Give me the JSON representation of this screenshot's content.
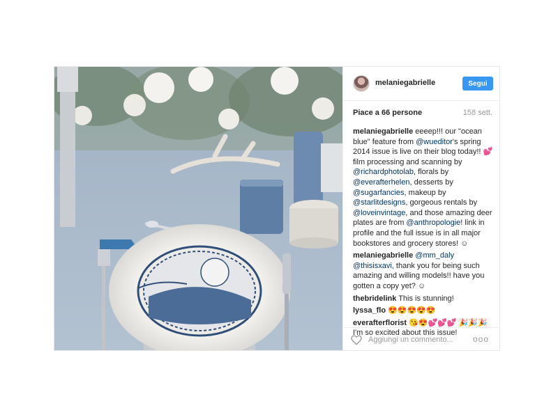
{
  "post": {
    "username": "melaniegabrielle",
    "follow_label": "Segui",
    "likes": "Piace a 66 persone",
    "time_ago": "158 sett.",
    "comment_placeholder": "Aggiungi un commento...",
    "more_label": "ooo"
  },
  "comments": [
    {
      "user": "melaniegabrielle",
      "parts": [
        {
          "t": " eeeep!!! our \"ocean blue\" feature from "
        },
        {
          "t": "@wueditor",
          "m": true
        },
        {
          "t": "'s spring 2014 issue is live on their blog today!! 💕 film processing and scanning by "
        },
        {
          "t": "@richardphotolab",
          "m": true
        },
        {
          "t": ", florals by "
        },
        {
          "t": "@everafterhelen",
          "m": true
        },
        {
          "t": ", desserts by "
        },
        {
          "t": "@sugarfancies",
          "m": true
        },
        {
          "t": ", makeup by "
        },
        {
          "t": "@starlitdesigns",
          "m": true
        },
        {
          "t": ", gorgeous rentals by "
        },
        {
          "t": "@loveinvintage",
          "m": true
        },
        {
          "t": ", and those amazing deer plates are from "
        },
        {
          "t": "@anthropologie",
          "m": true
        },
        {
          "t": "! link in profile and the full issue is in all major bookstores and grocery stores! ☺"
        }
      ]
    },
    {
      "user": "melaniegabrielle",
      "parts": [
        {
          "t": " "
        },
        {
          "t": "@mm_daly",
          "m": true
        },
        {
          "t": " "
        },
        {
          "t": "@thisisxavi",
          "m": true
        },
        {
          "t": ", thank you for being such amazing and willing models!! have you gotten a copy yet? ☺"
        }
      ]
    },
    {
      "user": "thebridelink",
      "parts": [
        {
          "t": " This is stunning!"
        }
      ]
    },
    {
      "user": "lyssa_flo",
      "parts": [
        {
          "t": " 😍😍😍😍😍"
        }
      ]
    },
    {
      "user": "everafterflorist",
      "parts": [
        {
          "t": " 😘😍💕💕💕 🎉🎉🎉 I'm so excited about this issue!"
        }
      ]
    }
  ],
  "colors": {
    "follow_button": "#3897f0",
    "mention": "#003569",
    "muted": "#999999"
  },
  "icons": {
    "like": "heart-outline-icon",
    "more": "more-dots-icon"
  }
}
